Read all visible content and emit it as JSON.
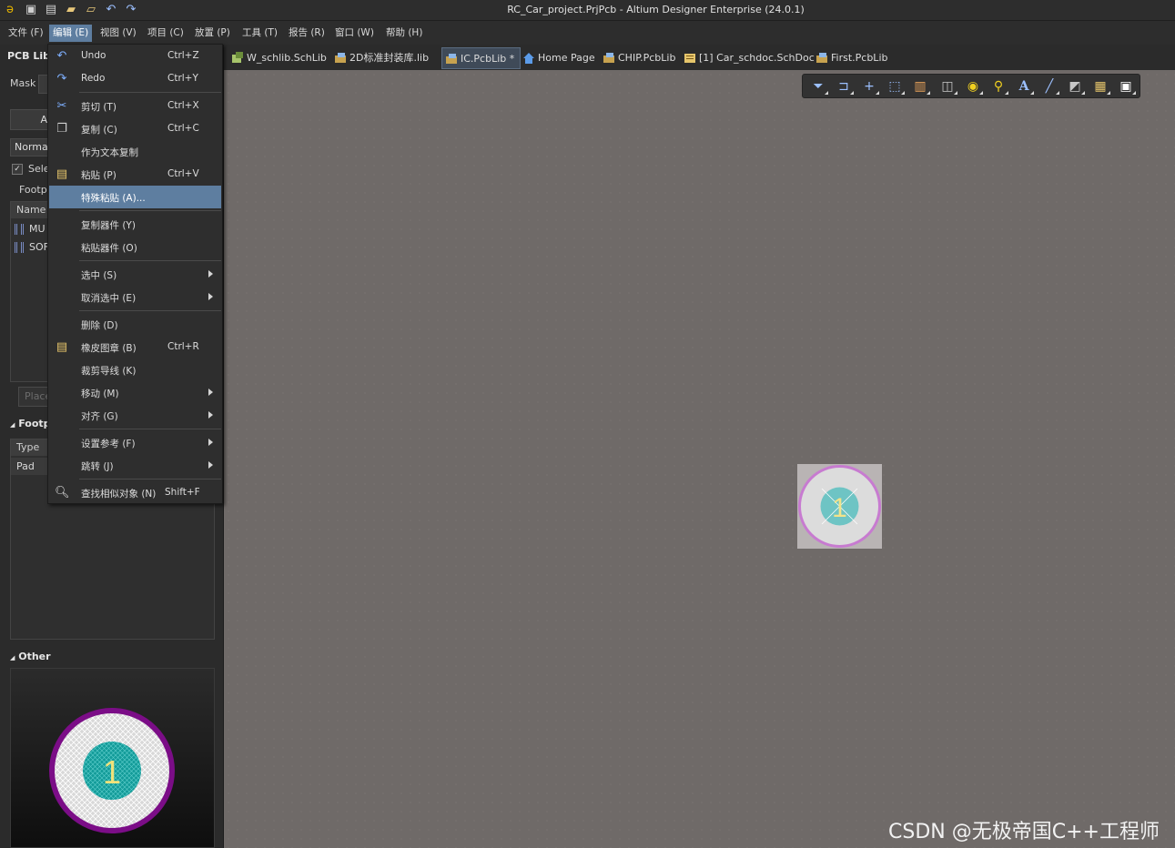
{
  "window": {
    "title": "RC_Car_project.PrjPcb - Altium Designer Enterprise (24.0.1)"
  },
  "menubar": {
    "items": [
      "文件 (F)",
      "编辑 (E)",
      "视图 (V)",
      "项目 (C)",
      "放置 (P)",
      "工具 (T)",
      "报告 (R)",
      "窗口 (W)",
      "帮助 (H)"
    ]
  },
  "tabs": [
    {
      "label": "W_schlib.SchLib",
      "icon": "schlib-icon"
    },
    {
      "label": "2D标准封装库.lib",
      "icon": "pcblib-icon"
    },
    {
      "label": "IC.PcbLib *",
      "icon": "pcblib-icon"
    },
    {
      "label": "Home Page",
      "icon": "home-icon"
    },
    {
      "label": "CHIP.PcbLib",
      "icon": "pcblib-icon"
    },
    {
      "label": "[1] Car_schdoc.SchDoc",
      "icon": "schdoc-icon"
    },
    {
      "label": "First.PcbLib",
      "icon": "pcblib-icon"
    }
  ],
  "left_panel": {
    "title": "PCB Libr",
    "mask_label": "Mask",
    "mode_value": "Norma",
    "select_label": "Sele",
    "footprints_tab": "Footp",
    "name_header": "Name",
    "footprint_rows": [
      "MU",
      "SOF"
    ],
    "place_button": "Place",
    "footprint_primitives_section": "Footp",
    "type_header": "Type",
    "type_rows": [
      "Pad"
    ],
    "other_section": "Other",
    "button_a": "A"
  },
  "edit_menu": {
    "items": [
      {
        "label": "Undo",
        "shortcut": "Ctrl+Z",
        "icon": "undo-icon"
      },
      {
        "label": "Redo",
        "shortcut": "Ctrl+Y",
        "icon": "redo-icon"
      },
      {
        "label": "剪切 (T)",
        "shortcut": "Ctrl+X",
        "icon": "cut-icon"
      },
      {
        "label": "复制 (C)",
        "shortcut": "Ctrl+C",
        "icon": "copy-icon"
      },
      {
        "label": "作为文本复制",
        "shortcut": ""
      },
      {
        "label": "粘贴 (P)",
        "shortcut": "Ctrl+V",
        "icon": "paste-icon"
      },
      {
        "label": "特殊粘贴 (A)...",
        "shortcut": "",
        "highlighted": true
      },
      {
        "label": "复制器件 (Y)",
        "shortcut": ""
      },
      {
        "label": "粘贴器件 (O)",
        "shortcut": ""
      },
      {
        "label": "选中 (S)",
        "shortcut": "",
        "submenu": true
      },
      {
        "label": "取消选中 (E)",
        "shortcut": "",
        "submenu": true
      },
      {
        "label": "删除 (D)",
        "shortcut": ""
      },
      {
        "label": "橡皮图章 (B)",
        "shortcut": "Ctrl+R",
        "icon": "rubber-stamp-icon"
      },
      {
        "label": "裁剪导线 (K)",
        "shortcut": ""
      },
      {
        "label": "移动 (M)",
        "shortcut": "",
        "submenu": true
      },
      {
        "label": "对齐 (G)",
        "shortcut": "",
        "submenu": true
      },
      {
        "label": "设置参考 (F)",
        "shortcut": "",
        "submenu": true
      },
      {
        "label": "跳转 (J)",
        "shortcut": "",
        "submenu": true
      },
      {
        "label": "查找相似对象 (N)",
        "shortcut": "Shift+F",
        "icon": "find-similar-icon"
      }
    ]
  },
  "canvas": {
    "pad_number": "1",
    "background": "#6f6a68"
  },
  "preview": {
    "pad_number": "1"
  },
  "watermark": "CSDN @无极帝国C++工程师",
  "colors": {
    "accent": "#5e7ea0",
    "pad_ring": "#c77bd0",
    "pad_center": "#6ec4c4",
    "preview_ring": "#7b0d87",
    "preview_center": "#139b99"
  }
}
